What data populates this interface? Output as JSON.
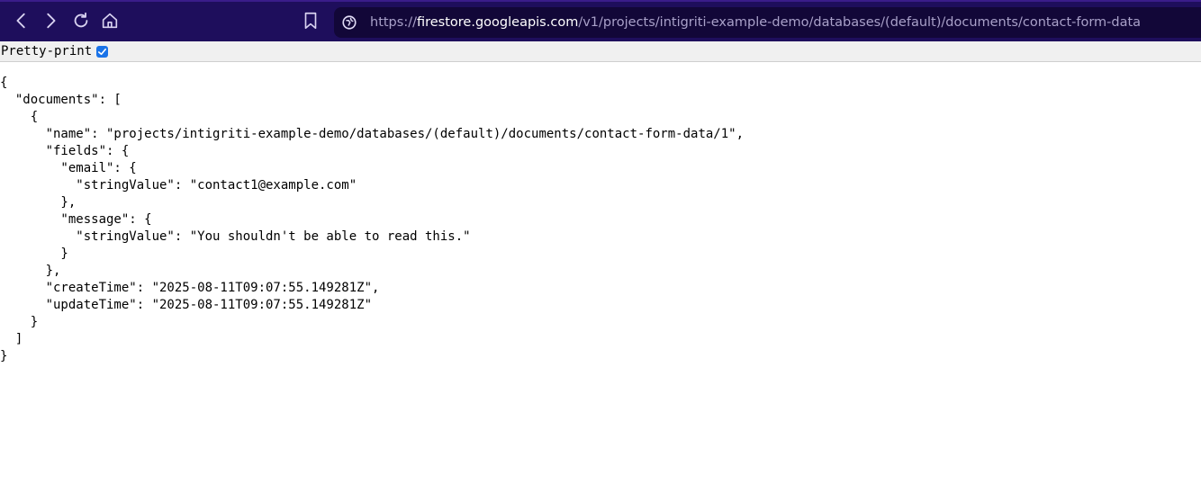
{
  "browser": {
    "url_scheme": "https://",
    "url_host": "firestore.googleapis.com",
    "url_path": "/v1/projects/intigriti-example-demo/databases/(default)/documents/contact-form-data",
    "icons": {
      "back": "chevron-left-icon",
      "forward": "chevron-right-icon",
      "reload": "reload-icon",
      "home": "home-icon",
      "bookmark": "bookmark-icon",
      "site": "site-info-icon"
    },
    "colors": {
      "toolbar": "#1e0e5c",
      "urlbar": "#120738"
    }
  },
  "pretty_print": {
    "label": "Pretty-print",
    "checked": true
  },
  "json_lines": [
    "{",
    "  \"documents\": [",
    "    {",
    "      \"name\": \"projects/intigriti-example-demo/databases/(default)/documents/contact-form-data/1\",",
    "      \"fields\": {",
    "        \"email\": {",
    "          \"stringValue\": \"contact1@example.com\"",
    "        },",
    "        \"message\": {",
    "          \"stringValue\": \"You shouldn't be able to read this.\"",
    "        }",
    "      },",
    "      \"createTime\": \"2025-08-11T09:07:55.149281Z\",",
    "      \"updateTime\": \"2025-08-11T09:07:55.149281Z\"",
    "    }",
    "  ]",
    "}"
  ]
}
